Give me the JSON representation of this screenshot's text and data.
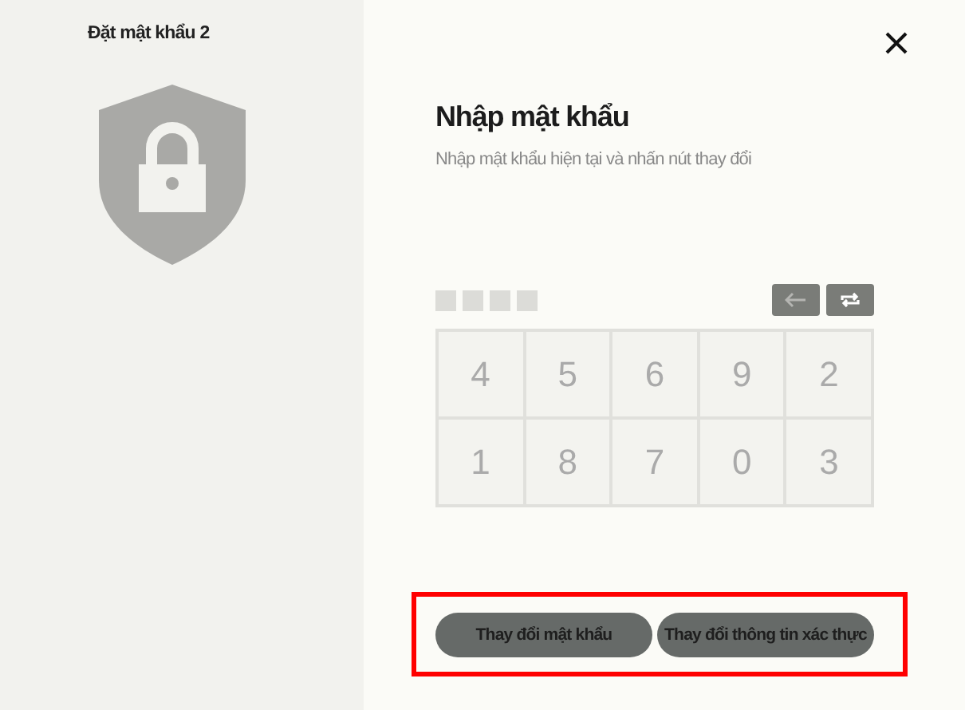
{
  "sidebar": {
    "title": "Đặt mật khẩu 2"
  },
  "main": {
    "heading": "Nhập mật khẩu",
    "subtitle": "Nhập mật khẩu hiện tại và nhấn nút thay đổi",
    "pin_slots": [
      {
        "filled": false
      },
      {
        "filled": false
      },
      {
        "filled": false
      },
      {
        "filled": false
      }
    ],
    "keypad": [
      "4",
      "5",
      "6",
      "9",
      "2",
      "1",
      "8",
      "7",
      "0",
      "3"
    ],
    "buttons": [
      "Thay đổi mật khẩu",
      "Thay đổi thông tin xác thực"
    ],
    "highlighted": true
  }
}
